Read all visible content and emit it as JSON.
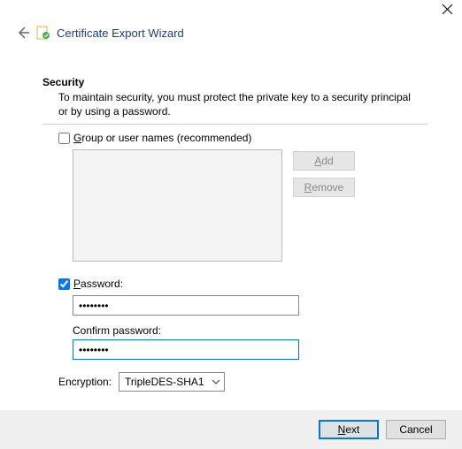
{
  "window": {
    "title": "Certificate Export Wizard"
  },
  "section": {
    "heading": "Security",
    "description": "To maintain security, you must protect the private key to a security principal or by using a password."
  },
  "group_option": {
    "checked": false,
    "label": "Group or user names (recommended)"
  },
  "buttons": {
    "add": "Add",
    "remove": "Remove",
    "next": "Next",
    "cancel": "Cancel"
  },
  "password_option": {
    "checked": true,
    "label": "Password:",
    "value": "••••••••",
    "confirm_label": "Confirm password:",
    "confirm_value": "••••••••"
  },
  "encryption": {
    "label": "Encryption:",
    "selected": "TripleDES-SHA1"
  }
}
